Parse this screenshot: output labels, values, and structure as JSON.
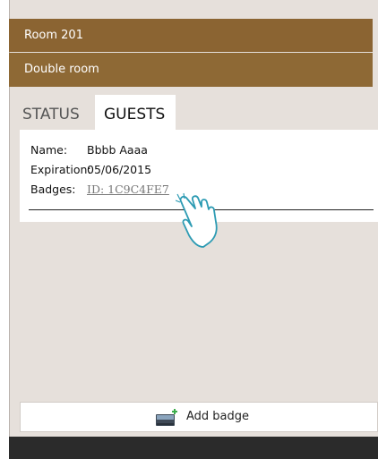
{
  "room": {
    "number": "Room 201",
    "type": "Double room"
  },
  "tabs": [
    {
      "label": "STATUS"
    },
    {
      "label": "GUESTS"
    }
  ],
  "guest": {
    "name_label": "Name:",
    "name_value": "Bbbb Aaaa",
    "expiration_label": "Expiration:",
    "expiration_value": "05/06/2015",
    "badges_label": "Badges:",
    "badge_value": "ID: 1C9C4FE7"
  },
  "actions": {
    "add_badge_label": "Add badge"
  },
  "icons": {
    "pointer": "hand-pointer-icon",
    "badge": "add-badge-icon"
  },
  "colors": {
    "header": "#8b6432",
    "panel": "#e6e0db",
    "footer": "#2b2b2b"
  }
}
